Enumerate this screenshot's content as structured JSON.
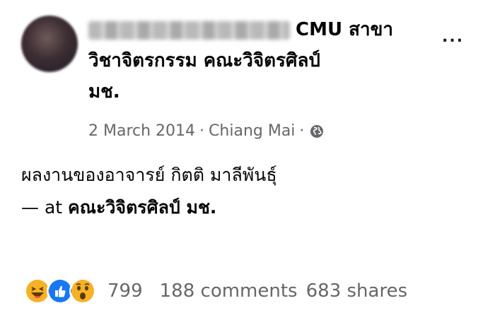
{
  "author": {
    "name_suffix_line1": "CMU สาขา",
    "name_line2": "วิชาจิตรกรรม คณะวิจิตรศิลป์",
    "name_line3": "มช."
  },
  "more_label": "...",
  "meta": {
    "date": "2 March 2014",
    "separator": "·",
    "location": "Chiang Mai",
    "separator2": "·",
    "privacy_icon": "globe-icon"
  },
  "post": {
    "line1": "ผลงานของอาจารย์ กิตติ มาลีพันธุ์",
    "at_prefix": "— at",
    "at_place": "คณะวิจิตรศิลป์ มช."
  },
  "footer": {
    "reaction_icons": [
      "haha-icon",
      "like-icon",
      "wow-icon"
    ],
    "reaction_count": "799",
    "comments": "188 comments",
    "shares": "683 shares"
  },
  "colors": {
    "meta_text": "#65676b",
    "like_blue": "#1877f2",
    "emoji_yellow": "#f7b125"
  }
}
